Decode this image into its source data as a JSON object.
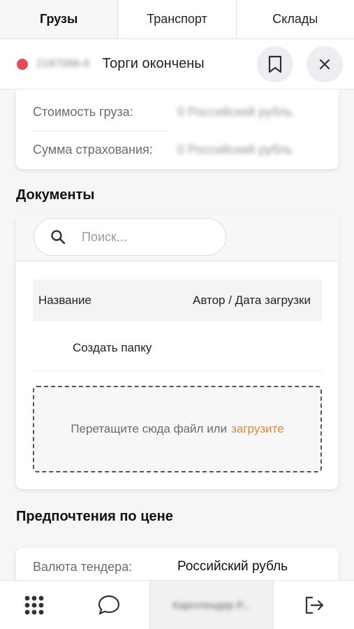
{
  "tabs": [
    {
      "label": "Грузы",
      "active": true
    },
    {
      "label": "Транспорт",
      "active": false
    },
    {
      "label": "Склады",
      "active": false
    }
  ],
  "header": {
    "order_id": "2187066-6",
    "status_title": "Торги окончены",
    "status_color": "#e64b5a",
    "bookmark_icon": "bookmark-icon",
    "close_icon": "close-icon"
  },
  "cargo": {
    "cost_label": "Стоимость груза:",
    "cost_value": "0 Российский рубль",
    "insurance_label": "Сумма страхования:",
    "insurance_value": "0 Российский рубль"
  },
  "documents": {
    "title": "Документы",
    "search_placeholder": "Поиск...",
    "col_name": "Название",
    "col_author": "Автор / Дата загрузки",
    "create_folder": "Создать папку",
    "dropzone_text": "Перетащите сюда файл или",
    "upload_link": "загрузите",
    "upload_color": "#e0893a"
  },
  "price_prefs": {
    "title": "Предпочтения по цене",
    "currency_label": "Валюта тендера:",
    "currency_value": "Российский рубль"
  },
  "bottom_nav": {
    "apps_icon": "grid-icon",
    "chat_icon": "chat-icon",
    "account_label": "Карготендер Р...",
    "logout_icon": "logout-icon"
  }
}
